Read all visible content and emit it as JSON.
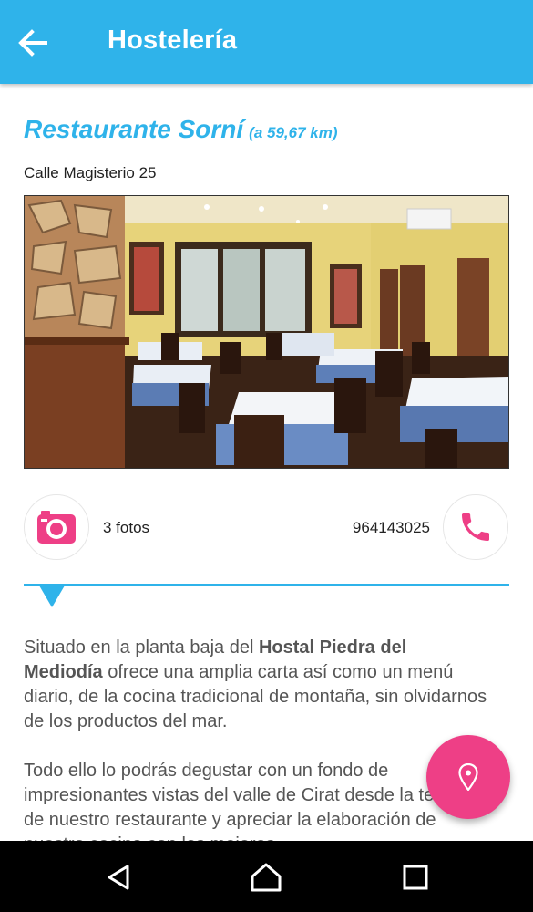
{
  "app_bar": {
    "title": "Hostelería",
    "back_icon": "arrow-left-icon"
  },
  "restaurant": {
    "name": "Restaurante Sorní",
    "distance": "(a 59,67 km)",
    "address": "Calle Magisterio 25",
    "photo_alt": "Comedor del restaurante",
    "photos_count": "3 fotos",
    "phone": "964143025"
  },
  "description": {
    "p1_before": "Situado en la planta baja del ",
    "p1_bold": "Hostal Piedra del Mediodía",
    "p1_after": " ofrece una amplia carta así como un menú diario, de la cocina tradicional de montaña, sin olvidarnos de los productos del mar.",
    "p2": "Todo ello lo podrás degustar con un fondo de impresionantes vistas del valle de Cirat desde la terraza de nuestro restaurante y apreciar la elaboración de nuestra cocina con los mejores"
  },
  "icons": {
    "photos": "camera-icon",
    "call": "phone-icon",
    "fab": "map-pin-icon",
    "nav_back": "nav-back-icon",
    "nav_home": "nav-home-icon",
    "nav_recents": "nav-recents-icon"
  },
  "colors": {
    "primary": "#2fb3ea",
    "accent": "#ee3f86",
    "navbar": "#000000"
  }
}
